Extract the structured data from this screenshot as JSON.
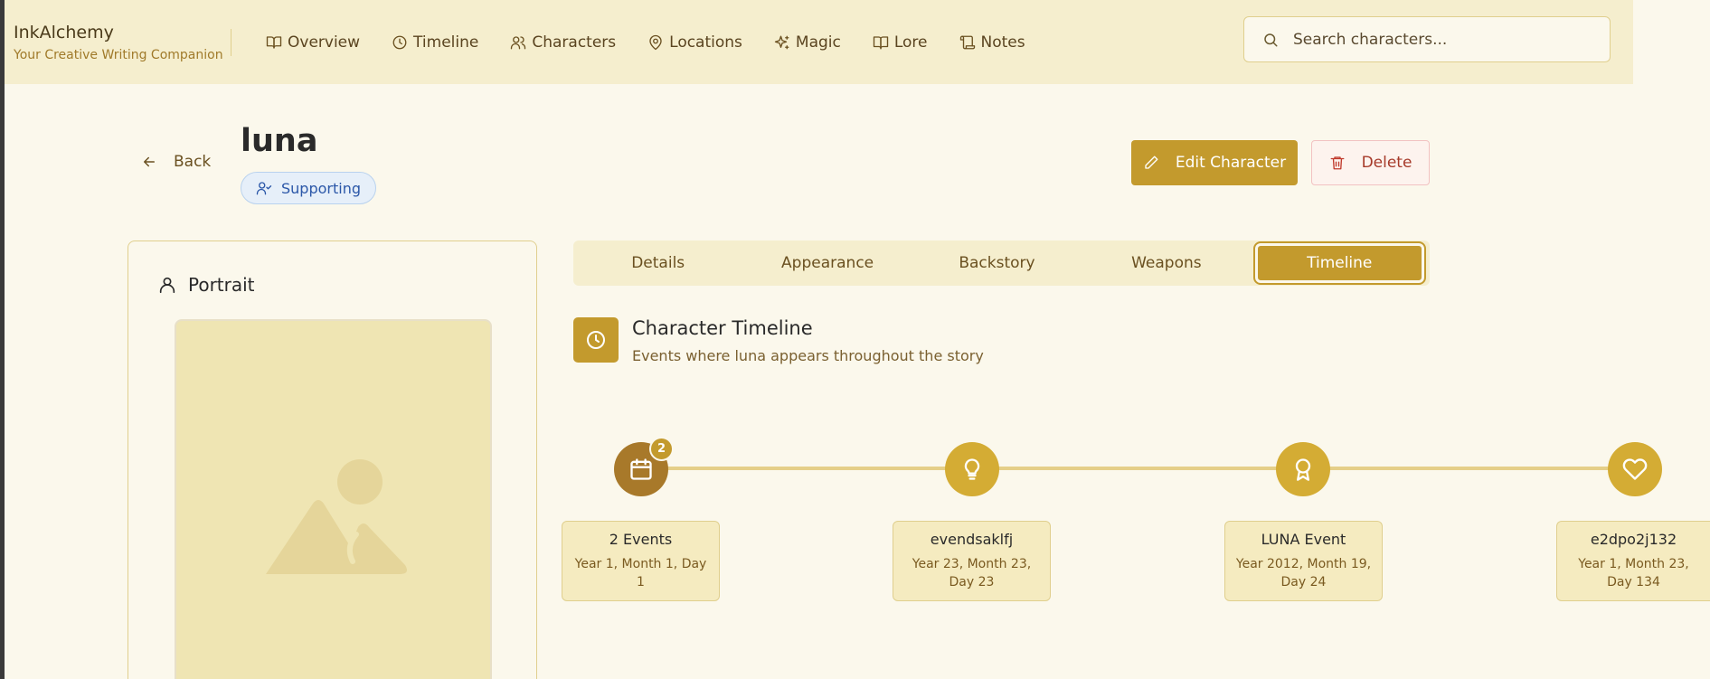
{
  "app": {
    "name": "InkAlchemy",
    "tagline": "Your Creative Writing Companion"
  },
  "nav": [
    {
      "label": "Overview",
      "icon": "book-open-icon"
    },
    {
      "label": "Timeline",
      "icon": "clock-icon"
    },
    {
      "label": "Characters",
      "icon": "users-icon"
    },
    {
      "label": "Locations",
      "icon": "map-pin-icon"
    },
    {
      "label": "Magic",
      "icon": "sparkles-icon"
    },
    {
      "label": "Lore",
      "icon": "book-icon"
    },
    {
      "label": "Notes",
      "icon": "scroll-icon"
    }
  ],
  "search": {
    "placeholder": "Search characters..."
  },
  "header": {
    "back_label": "Back",
    "title": "luna",
    "role_badge": "Supporting"
  },
  "actions": {
    "edit_label": "Edit Character",
    "delete_label": "Delete"
  },
  "portrait": {
    "heading": "Portrait"
  },
  "tabs": [
    {
      "label": "Details",
      "active": false
    },
    {
      "label": "Appearance",
      "active": false
    },
    {
      "label": "Backstory",
      "active": false
    },
    {
      "label": "Weapons",
      "active": false
    },
    {
      "label": "Timeline",
      "active": true
    }
  ],
  "timeline": {
    "title": "Character Timeline",
    "subtitle": "Events where luna appears throughout the story",
    "events": [
      {
        "name": "2 Events",
        "date": "Year 1, Month 1, Day 1",
        "icon": "calendar-icon",
        "count": "2",
        "color": "#a8792a"
      },
      {
        "name": "evendsaklfj",
        "date": "Year 23, Month 23, Day 23",
        "icon": "lightbulb-icon",
        "color": "#d4ac34"
      },
      {
        "name": "LUNA Event",
        "date": "Year 2012, Month 19, Day 24",
        "icon": "award-icon",
        "color": "#d4ac34"
      },
      {
        "name": "e2dpo2j132",
        "date": "Year 1, Month 23, Day 134",
        "icon": "heart-icon",
        "color": "#d4ac34"
      }
    ]
  },
  "colors": {
    "accent": "#c39a2d",
    "background": "#fbf8ec",
    "topbar": "#f5eece",
    "danger": "#c0392b",
    "badge_blue": "#2b57a8"
  }
}
